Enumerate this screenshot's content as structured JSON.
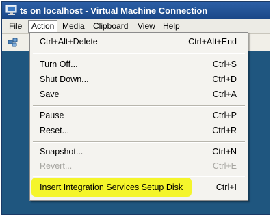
{
  "window": {
    "title": "ts on localhost - Virtual Machine Connection",
    "title_icon": "vm-monitor-icon",
    "toolbar_icon": "ctrl-alt-del-icon"
  },
  "menubar": {
    "items": [
      "File",
      "Action",
      "Media",
      "Clipboard",
      "View",
      "Help"
    ],
    "active": "Action"
  },
  "action_menu": {
    "items": [
      {
        "label": "Ctrl+Alt+Delete",
        "shortcut": "Ctrl+Alt+End",
        "enabled": true
      },
      {
        "label": "Turn Off...",
        "shortcut": "Ctrl+S",
        "enabled": true
      },
      {
        "label": "Shut Down...",
        "shortcut": "Ctrl+D",
        "enabled": true
      },
      {
        "label": "Save",
        "shortcut": "Ctrl+A",
        "enabled": true
      },
      {
        "label": "Pause",
        "shortcut": "Ctrl+P",
        "enabled": true
      },
      {
        "label": "Reset...",
        "shortcut": "Ctrl+R",
        "enabled": true
      },
      {
        "label": "Snapshot...",
        "shortcut": "Ctrl+N",
        "enabled": true
      },
      {
        "label": "Revert...",
        "shortcut": "Ctrl+E",
        "enabled": false
      },
      {
        "label": "Insert Integration Services Setup Disk",
        "shortcut": "Ctrl+I",
        "enabled": true,
        "highlighted": true
      }
    ]
  },
  "colors": {
    "vm_background": "#1f567f",
    "highlight": "#f3f51a",
    "title_bar": "#2c5fa6"
  }
}
